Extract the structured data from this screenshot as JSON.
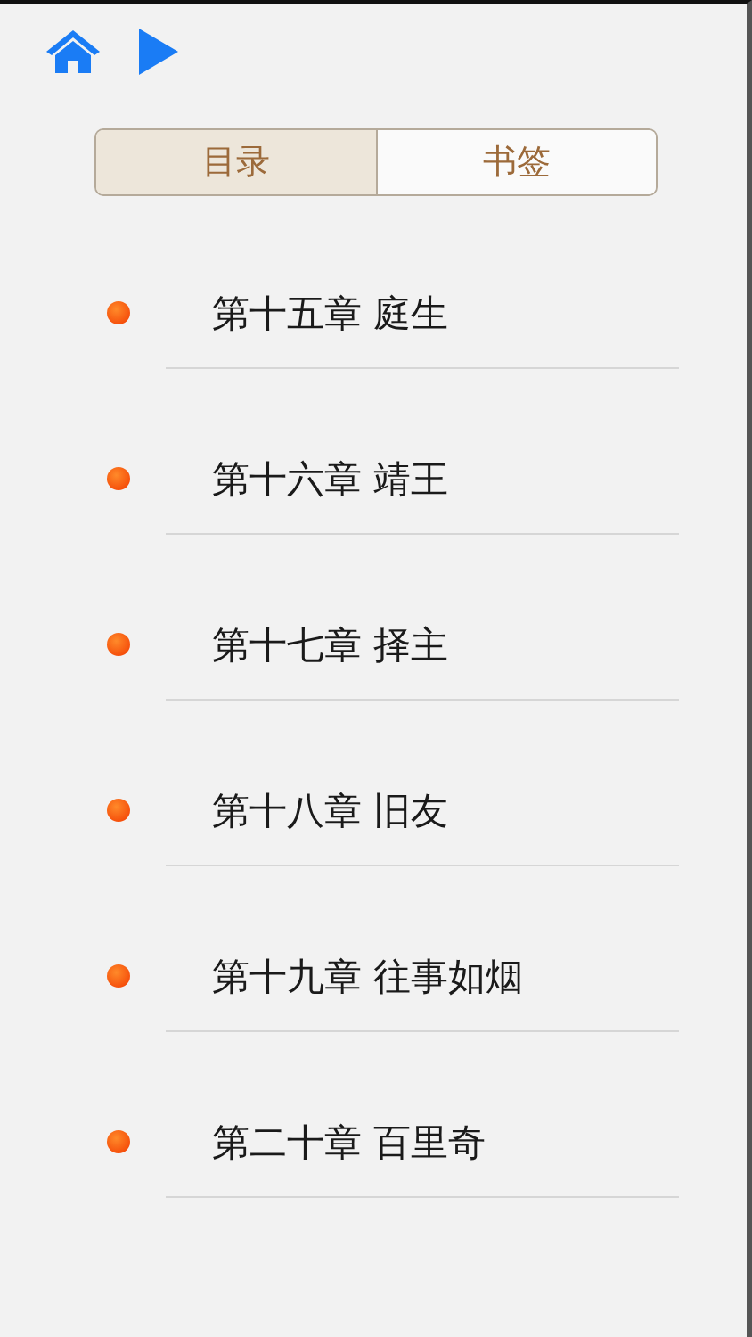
{
  "tabs": [
    {
      "label": "目录",
      "selected": true
    },
    {
      "label": "书签",
      "selected": false
    }
  ],
  "chapters": [
    {
      "title": "第十五章 庭生"
    },
    {
      "title": "第十六章 靖王"
    },
    {
      "title": "第十七章 择主"
    },
    {
      "title": "第十八章 旧友"
    },
    {
      "title": "第十九章 往事如烟"
    },
    {
      "title": "第二十章 百里奇"
    }
  ]
}
